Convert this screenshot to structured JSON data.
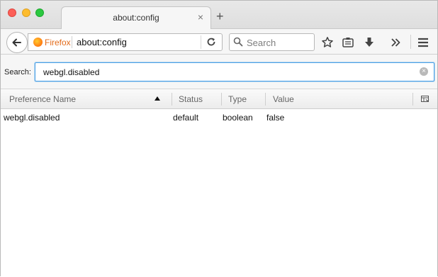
{
  "browser": {
    "tab": {
      "title": "about:config",
      "close_glyph": "×"
    },
    "new_tab_glyph": "+",
    "identity_label": "Firefox",
    "url": "about:config",
    "search_placeholder": "Search",
    "icons": [
      "back-arrow-icon",
      "firefox-logo-icon",
      "reload-icon",
      "search-icon",
      "bookmark-star-icon",
      "reading-list-icon",
      "downloads-icon",
      "overflow-chevron-icon",
      "hamburger-menu-icon"
    ]
  },
  "config": {
    "search_label": "Search:",
    "search_value": "webgl.disabled",
    "columns": [
      "Preference Name",
      "Status",
      "Type",
      "Value"
    ],
    "sorted_column": "Preference Name",
    "rows": [
      {
        "name": "webgl.disabled",
        "status": "default",
        "type": "boolean",
        "value": "false"
      }
    ]
  },
  "colors": {
    "accent_focus": "#4ba0e6",
    "firefox_orange": "#e36b1a",
    "traffic_red": "#fc5f57",
    "traffic_yellow": "#fdbc2e",
    "traffic_green": "#2bc840"
  }
}
